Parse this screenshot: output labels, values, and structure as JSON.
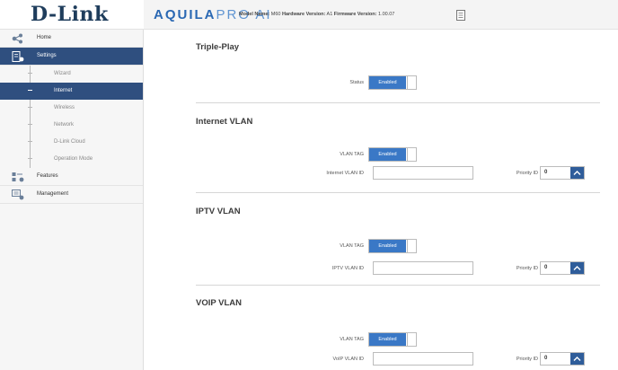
{
  "header": {
    "logo": "D-Link",
    "brand_main": "AQUILA",
    "brand_light": "PRO AI",
    "model_label": "Model Name:",
    "model_value": "M60",
    "hw_label": "Hardware Version:",
    "hw_value": "A1",
    "fw_label": "Firmware Version:",
    "fw_value": "1.00.07"
  },
  "sidebar": {
    "items": [
      {
        "label": "Home",
        "icon": "home-network-icon"
      },
      {
        "label": "Settings",
        "icon": "settings-icon"
      },
      {
        "label": "Features",
        "icon": "features-icon"
      },
      {
        "label": "Management",
        "icon": "management-icon"
      }
    ],
    "settings_sub": [
      {
        "label": "Wizard"
      },
      {
        "label": "Internet"
      },
      {
        "label": "Wireless"
      },
      {
        "label": "Network"
      },
      {
        "label": "D-Link Cloud"
      },
      {
        "label": "Operation Mode"
      }
    ]
  },
  "triple_play": {
    "title": "Triple-Play",
    "status_label": "Status",
    "status_value": "Enabled"
  },
  "internet_vlan": {
    "title": "Internet VLAN",
    "tag_label": "VLAN TAG",
    "tag_value": "Enabled",
    "id_label": "Internet VLAN ID",
    "id_value": "",
    "priority_label": "Priority ID",
    "priority_value": "0"
  },
  "iptv_vlan": {
    "title": "IPTV VLAN",
    "tag_label": "VLAN TAG",
    "tag_value": "Enabled",
    "id_label": "IPTV VLAN ID",
    "id_value": "",
    "priority_label": "Priority ID",
    "priority_value": "0"
  },
  "voip_vlan": {
    "title": "VOIP VLAN",
    "tag_label": "VLAN TAG",
    "tag_value": "Enabled",
    "id_label": "VoIP VLAN ID",
    "id_value": "",
    "priority_label": "Priority ID",
    "priority_value": "0"
  },
  "colors": {
    "accent": "#3a78c6",
    "nav_active": "#2f4f7f",
    "logo": "#1f3d5c",
    "brand": "#2a68b3"
  }
}
